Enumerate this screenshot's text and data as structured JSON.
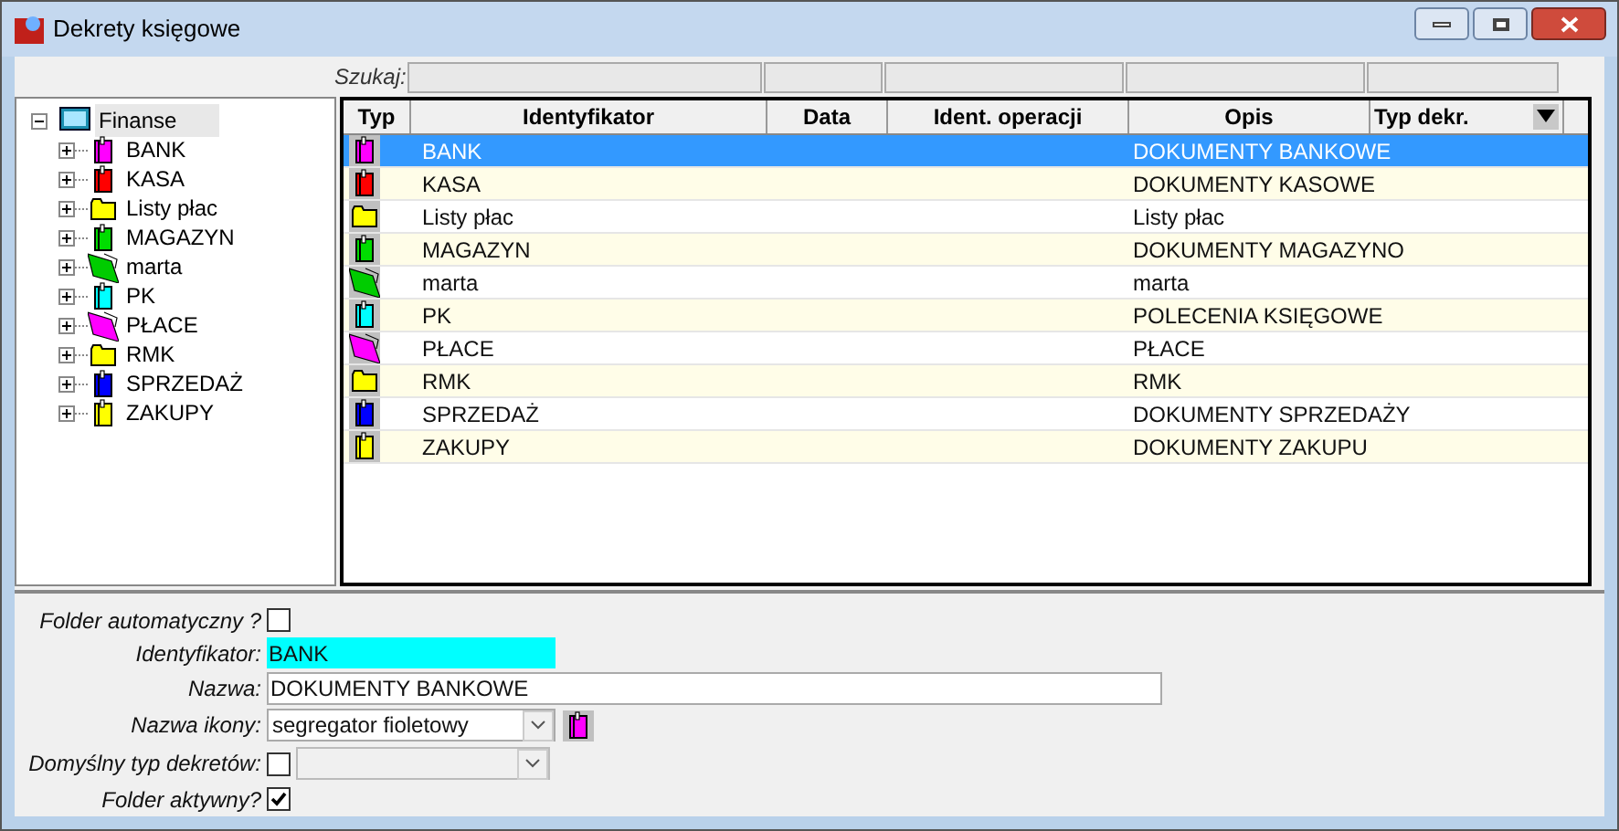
{
  "window": {
    "title": "Dekrety księgowe"
  },
  "search": {
    "label": "Szukaj:"
  },
  "tree": {
    "label": "Finanse",
    "expanded": true,
    "selected": true,
    "children": [
      {
        "label": "BANK",
        "kind": "binder",
        "color": "#ff00ff",
        "expanded": false,
        "selected": false
      },
      {
        "label": "KASA",
        "kind": "binder",
        "color": "#ff0000",
        "expanded": false,
        "selected": false
      },
      {
        "label": "Listy płac",
        "kind": "folder",
        "color": "#ffff00",
        "expanded": false,
        "selected": false
      },
      {
        "label": "MAGAZYN",
        "kind": "binder",
        "color": "#00dd00",
        "expanded": false,
        "selected": false
      },
      {
        "label": "marta",
        "kind": "open",
        "color": "#00cc00",
        "expanded": false,
        "selected": false
      },
      {
        "label": "PK",
        "kind": "binder",
        "color": "#00ffff",
        "expanded": false,
        "selected": false
      },
      {
        "label": "PŁACE",
        "kind": "open",
        "color": "#ff00ff",
        "expanded": false,
        "selected": false
      },
      {
        "label": "RMK",
        "kind": "folder",
        "color": "#ffff00",
        "expanded": false,
        "selected": false
      },
      {
        "label": "SPRZEDAŻ",
        "kind": "binder",
        "color": "#0000ff",
        "expanded": false,
        "selected": false
      },
      {
        "label": "ZAKUPY",
        "kind": "binder",
        "color": "#ffff00",
        "expanded": false,
        "selected": false
      }
    ]
  },
  "table": {
    "columns": [
      "Typ",
      "Identyfikator",
      "Data",
      "Ident. operacji",
      "Opis",
      "Typ dekr."
    ],
    "rows": [
      {
        "kind": "binder",
        "color": "#ff00ff",
        "identyfikator": "BANK",
        "opis": "DOKUMENTY BANKOWE",
        "selected": true
      },
      {
        "kind": "binder",
        "color": "#ff0000",
        "identyfikator": "KASA",
        "opis": "DOKUMENTY KASOWE",
        "selected": false
      },
      {
        "kind": "folder",
        "color": "#ffff00",
        "identyfikator": "Listy płac",
        "opis": "Listy płac",
        "selected": false
      },
      {
        "kind": "binder",
        "color": "#00dd00",
        "identyfikator": "MAGAZYN",
        "opis": "DOKUMENTY MAGAZYNO",
        "selected": false
      },
      {
        "kind": "open",
        "color": "#00cc00",
        "identyfikator": "marta",
        "opis": "marta",
        "selected": false
      },
      {
        "kind": "binder",
        "color": "#00ffff",
        "identyfikator": "PK",
        "opis": "POLECENIA KSIĘGOWE",
        "selected": false
      },
      {
        "kind": "open",
        "color": "#ff00ff",
        "identyfikator": "PŁACE",
        "opis": "PŁACE",
        "selected": false
      },
      {
        "kind": "folder",
        "color": "#ffff00",
        "identyfikator": "RMK",
        "opis": "RMK",
        "selected": false
      },
      {
        "kind": "binder",
        "color": "#0000ff",
        "identyfikator": "SPRZEDAŻ",
        "opis": "DOKUMENTY SPRZEDAŻY",
        "selected": false
      },
      {
        "kind": "binder",
        "color": "#ffff00",
        "identyfikator": "ZAKUPY",
        "opis": "DOKUMENTY ZAKUPU",
        "selected": false
      }
    ]
  },
  "form": {
    "folder_automatyczny": {
      "label": "Folder automatyczny ?",
      "checked": false
    },
    "identyfikator": {
      "label": "Identyfikator:",
      "value": "BANK"
    },
    "nazwa": {
      "label": "Nazwa:",
      "value": "DOKUMENTY BANKOWE"
    },
    "nazwa_ikony": {
      "label": "Nazwa ikony:",
      "value": "segregator fioletowy",
      "kind": "binder",
      "color": "#ff00ff"
    },
    "domyslny_typ": {
      "label": "Domyślny typ dekretów:",
      "checked": false
    },
    "folder_aktywny": {
      "label": "Folder aktywny?",
      "checked": true
    }
  }
}
